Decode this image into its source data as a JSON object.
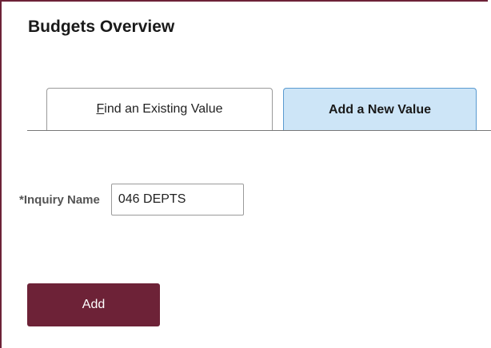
{
  "page": {
    "title": "Budgets Overview"
  },
  "tabs": {
    "find": {
      "label_first": "F",
      "label_rest": "ind an Existing Value"
    },
    "add": {
      "label": "Add a New Value"
    }
  },
  "form": {
    "inquiry_label": "*Inquiry Name",
    "inquiry_value": "046 DEPTS"
  },
  "actions": {
    "add_label": "Add"
  },
  "colors": {
    "brand": "#6d2237",
    "active_tab": "#cde5f7",
    "active_tab_border": "#5a9ad0"
  }
}
